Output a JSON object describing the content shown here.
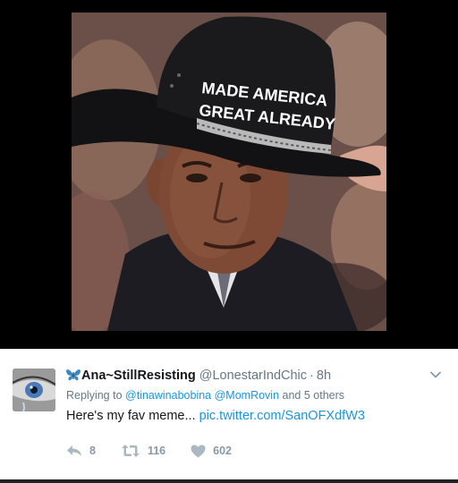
{
  "media": {
    "hat_text_line1": "MADE AMERICA",
    "hat_text_line2": "GREAT ALREADY"
  },
  "tweet": {
    "display_name": "Ana~StillResisting",
    "handle": "@LonestarIndChic",
    "separator": "·",
    "timestamp": "8h",
    "reply": {
      "prefix": "Replying to",
      "mention1": "@tinawinabobina",
      "mention2": "@MomRovin",
      "suffix": "and 5 others"
    },
    "text": "Here's my fav meme...",
    "link": "pic.twitter.com/SanOFXdfW3",
    "actions": {
      "replies": "8",
      "retweets": "116",
      "likes": "602"
    }
  },
  "icons": {
    "butterfly": "butterfly-icon",
    "caret": "chevron-down-icon",
    "reply": "reply-icon",
    "retweet": "retweet-icon",
    "like": "heart-icon"
  },
  "colors": {
    "link": "#1b95e0",
    "muted": "#657786",
    "action": "#8899a6",
    "text": "#14171a"
  }
}
